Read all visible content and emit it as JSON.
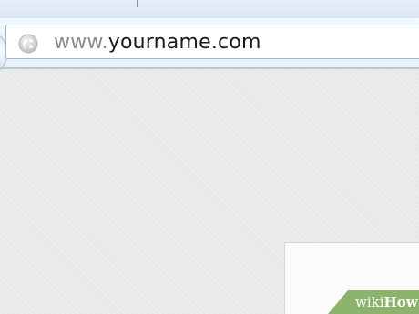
{
  "browser": {
    "address_bar": {
      "url_prefix": "www.",
      "url_domain": "yourname.com"
    },
    "icons": {
      "site_icon": "globe-icon"
    }
  },
  "watermark": {
    "brand_light": "wiki",
    "brand_bold": "How",
    "color": "#8cb36b"
  }
}
